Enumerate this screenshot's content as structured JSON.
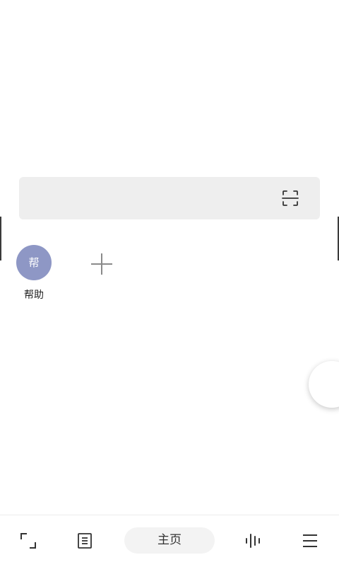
{
  "shortcuts": [
    {
      "avatar_char": "帮",
      "label": "帮助",
      "avatar_color": "#8e97c5"
    }
  ],
  "icons": {
    "scan": "scan-icon",
    "add": "plus-icon",
    "back": "back-corner-icon",
    "notes": "notes-icon",
    "voice": "voice-wave-icon",
    "menu": "menu-icon"
  },
  "bottom_nav": {
    "home_label": "主页"
  }
}
